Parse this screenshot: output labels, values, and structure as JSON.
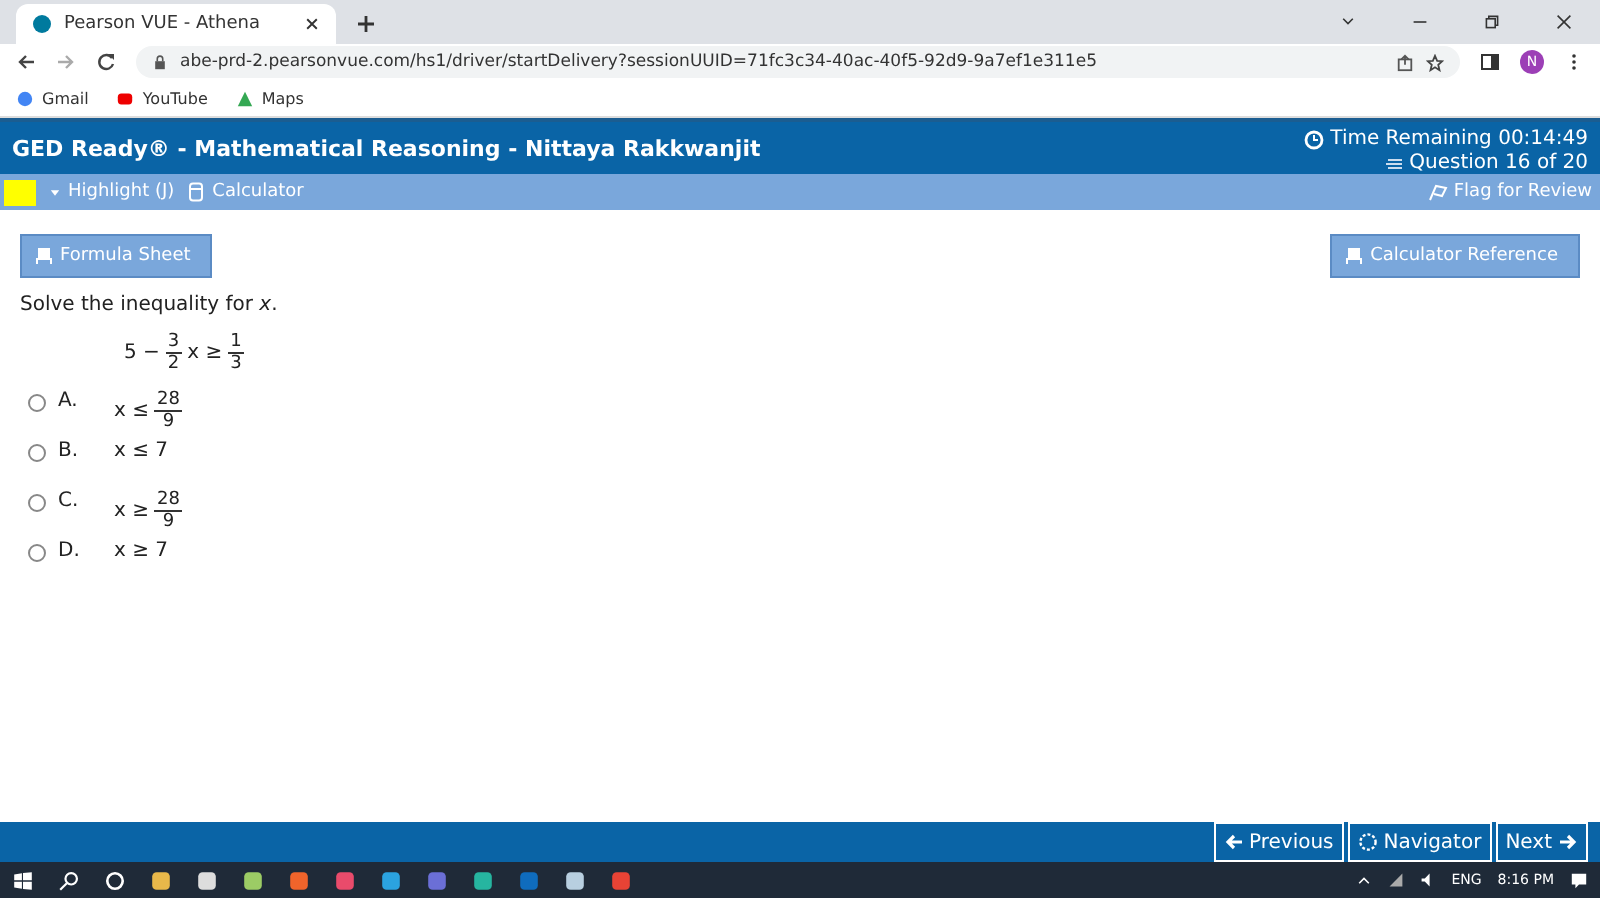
{
  "browser": {
    "tab_title": "Pearson VUE - Athena",
    "url": "abe-prd-2.pearsonvue.com/hs1/driver/startDelivery?sessionUUID=71fc3c34-40ac-40f5-92d9-9a7ef1e311e5",
    "profile_initial": "N",
    "bookmarks": [
      "Gmail",
      "YouTube",
      "Maps"
    ]
  },
  "header": {
    "title": "GED Ready® - Mathematical Reasoning - Nittaya Rakkwanjit",
    "timer": "Time Remaining 00:14:49",
    "progress": "Question 16 of 20"
  },
  "toolbar": {
    "highlight": "Highlight (J)",
    "calculator": "Calculator",
    "flag": "Flag for Review"
  },
  "buttons": {
    "formula_sheet": "Formula Sheet",
    "calculator_reference": "Calculator Reference"
  },
  "question": {
    "prompt": "Solve the inequality for *x*.",
    "expression": [
      {
        "kind": "text",
        "text": "5 −"
      },
      {
        "kind": "fraction",
        "numerator": "3",
        "denominator": "2"
      },
      {
        "kind": "text",
        "text": "x ≥"
      },
      {
        "kind": "fraction",
        "numerator": "1",
        "denominator": "3"
      }
    ]
  },
  "options": [
    {
      "letter": "A.",
      "selected": false,
      "parts": [
        {
          "kind": "text",
          "text": "x ≤"
        },
        {
          "kind": "fraction",
          "numerator": "28",
          "denominator": "9"
        }
      ]
    },
    {
      "letter": "B.",
      "selected": false,
      "parts": [
        {
          "kind": "text",
          "text": "x ≤ 7"
        }
      ]
    },
    {
      "letter": "C.",
      "selected": false,
      "parts": [
        {
          "kind": "text",
          "text": "x ≥"
        },
        {
          "kind": "fraction",
          "numerator": "28",
          "denominator": "9"
        }
      ]
    },
    {
      "letter": "D.",
      "selected": false,
      "parts": [
        {
          "kind": "text",
          "text": "x ≥ 7"
        }
      ]
    }
  ],
  "navigation": [
    "Previous",
    "Navigator",
    "Next"
  ],
  "taskbar": {
    "language": "ENG",
    "time": "8:16 PM"
  }
}
